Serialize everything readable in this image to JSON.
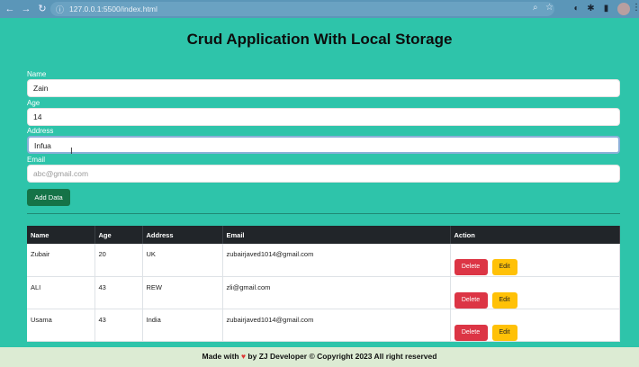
{
  "browser": {
    "url": "127.0.0.1:5500/index.html"
  },
  "page": {
    "title": "Crud Application With Local Storage"
  },
  "form": {
    "name_label": "Name",
    "name_value": "Zain",
    "age_label": "Age",
    "age_value": "14",
    "address_label": "Address",
    "address_value": "Infua",
    "email_label": "Email",
    "email_placeholder": "abc@gmail.com",
    "add_button": "Add Data"
  },
  "table": {
    "headers": [
      "Name",
      "Age",
      "Address",
      "Email",
      "Action"
    ],
    "rows": [
      {
        "name": "Zubair",
        "age": "20",
        "address": "UK",
        "email": "zubairjaved1014@gmail.com"
      },
      {
        "name": "ALI",
        "age": "43",
        "address": "REW",
        "email": "zli@gmail.com"
      },
      {
        "name": "Usama",
        "age": "43",
        "address": "India",
        "email": "zubairjaved1014@gmail.com"
      }
    ],
    "delete_label": "Delete",
    "edit_label": "Edit"
  },
  "footer": {
    "text_before": "Made with",
    "text_after": "by ZJ Developer",
    "copyright": "© Copyright 2023 All right reserved"
  },
  "colors": {
    "background": "#2ec4aa",
    "delete": "#dc3545",
    "edit": "#ffc107",
    "add": "#157347"
  }
}
